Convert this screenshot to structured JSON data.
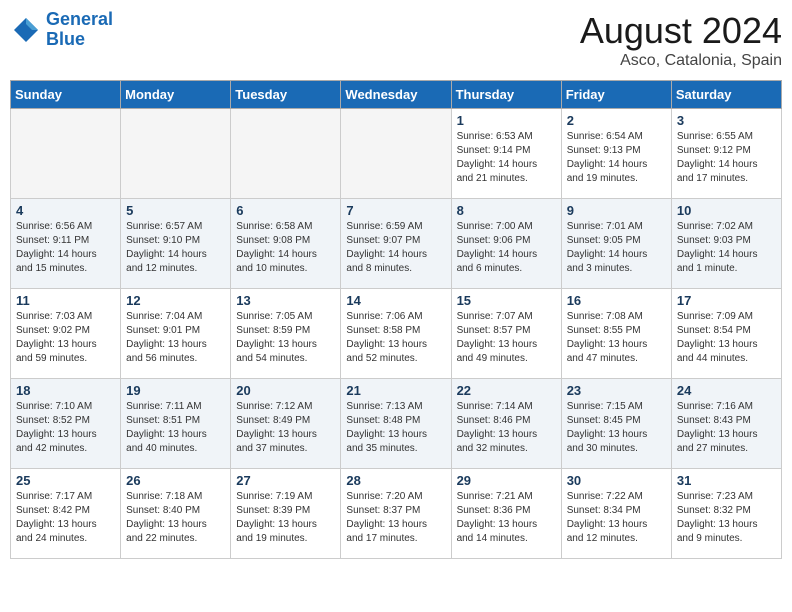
{
  "logo": {
    "line1": "General",
    "line2": "Blue"
  },
  "title": "August 2024",
  "location": "Asco, Catalonia, Spain",
  "weekdays": [
    "Sunday",
    "Monday",
    "Tuesday",
    "Wednesday",
    "Thursday",
    "Friday",
    "Saturday"
  ],
  "weeks": [
    [
      {
        "day": "",
        "info": ""
      },
      {
        "day": "",
        "info": ""
      },
      {
        "day": "",
        "info": ""
      },
      {
        "day": "",
        "info": ""
      },
      {
        "day": "1",
        "info": "Sunrise: 6:53 AM\nSunset: 9:14 PM\nDaylight: 14 hours\nand 21 minutes."
      },
      {
        "day": "2",
        "info": "Sunrise: 6:54 AM\nSunset: 9:13 PM\nDaylight: 14 hours\nand 19 minutes."
      },
      {
        "day": "3",
        "info": "Sunrise: 6:55 AM\nSunset: 9:12 PM\nDaylight: 14 hours\nand 17 minutes."
      }
    ],
    [
      {
        "day": "4",
        "info": "Sunrise: 6:56 AM\nSunset: 9:11 PM\nDaylight: 14 hours\nand 15 minutes."
      },
      {
        "day": "5",
        "info": "Sunrise: 6:57 AM\nSunset: 9:10 PM\nDaylight: 14 hours\nand 12 minutes."
      },
      {
        "day": "6",
        "info": "Sunrise: 6:58 AM\nSunset: 9:08 PM\nDaylight: 14 hours\nand 10 minutes."
      },
      {
        "day": "7",
        "info": "Sunrise: 6:59 AM\nSunset: 9:07 PM\nDaylight: 14 hours\nand 8 minutes."
      },
      {
        "day": "8",
        "info": "Sunrise: 7:00 AM\nSunset: 9:06 PM\nDaylight: 14 hours\nand 6 minutes."
      },
      {
        "day": "9",
        "info": "Sunrise: 7:01 AM\nSunset: 9:05 PM\nDaylight: 14 hours\nand 3 minutes."
      },
      {
        "day": "10",
        "info": "Sunrise: 7:02 AM\nSunset: 9:03 PM\nDaylight: 14 hours\nand 1 minute."
      }
    ],
    [
      {
        "day": "11",
        "info": "Sunrise: 7:03 AM\nSunset: 9:02 PM\nDaylight: 13 hours\nand 59 minutes."
      },
      {
        "day": "12",
        "info": "Sunrise: 7:04 AM\nSunset: 9:01 PM\nDaylight: 13 hours\nand 56 minutes."
      },
      {
        "day": "13",
        "info": "Sunrise: 7:05 AM\nSunset: 8:59 PM\nDaylight: 13 hours\nand 54 minutes."
      },
      {
        "day": "14",
        "info": "Sunrise: 7:06 AM\nSunset: 8:58 PM\nDaylight: 13 hours\nand 52 minutes."
      },
      {
        "day": "15",
        "info": "Sunrise: 7:07 AM\nSunset: 8:57 PM\nDaylight: 13 hours\nand 49 minutes."
      },
      {
        "day": "16",
        "info": "Sunrise: 7:08 AM\nSunset: 8:55 PM\nDaylight: 13 hours\nand 47 minutes."
      },
      {
        "day": "17",
        "info": "Sunrise: 7:09 AM\nSunset: 8:54 PM\nDaylight: 13 hours\nand 44 minutes."
      }
    ],
    [
      {
        "day": "18",
        "info": "Sunrise: 7:10 AM\nSunset: 8:52 PM\nDaylight: 13 hours\nand 42 minutes."
      },
      {
        "day": "19",
        "info": "Sunrise: 7:11 AM\nSunset: 8:51 PM\nDaylight: 13 hours\nand 40 minutes."
      },
      {
        "day": "20",
        "info": "Sunrise: 7:12 AM\nSunset: 8:49 PM\nDaylight: 13 hours\nand 37 minutes."
      },
      {
        "day": "21",
        "info": "Sunrise: 7:13 AM\nSunset: 8:48 PM\nDaylight: 13 hours\nand 35 minutes."
      },
      {
        "day": "22",
        "info": "Sunrise: 7:14 AM\nSunset: 8:46 PM\nDaylight: 13 hours\nand 32 minutes."
      },
      {
        "day": "23",
        "info": "Sunrise: 7:15 AM\nSunset: 8:45 PM\nDaylight: 13 hours\nand 30 minutes."
      },
      {
        "day": "24",
        "info": "Sunrise: 7:16 AM\nSunset: 8:43 PM\nDaylight: 13 hours\nand 27 minutes."
      }
    ],
    [
      {
        "day": "25",
        "info": "Sunrise: 7:17 AM\nSunset: 8:42 PM\nDaylight: 13 hours\nand 24 minutes."
      },
      {
        "day": "26",
        "info": "Sunrise: 7:18 AM\nSunset: 8:40 PM\nDaylight: 13 hours\nand 22 minutes."
      },
      {
        "day": "27",
        "info": "Sunrise: 7:19 AM\nSunset: 8:39 PM\nDaylight: 13 hours\nand 19 minutes."
      },
      {
        "day": "28",
        "info": "Sunrise: 7:20 AM\nSunset: 8:37 PM\nDaylight: 13 hours\nand 17 minutes."
      },
      {
        "day": "29",
        "info": "Sunrise: 7:21 AM\nSunset: 8:36 PM\nDaylight: 13 hours\nand 14 minutes."
      },
      {
        "day": "30",
        "info": "Sunrise: 7:22 AM\nSunset: 8:34 PM\nDaylight: 13 hours\nand 12 minutes."
      },
      {
        "day": "31",
        "info": "Sunrise: 7:23 AM\nSunset: 8:32 PM\nDaylight: 13 hours\nand 9 minutes."
      }
    ]
  ]
}
